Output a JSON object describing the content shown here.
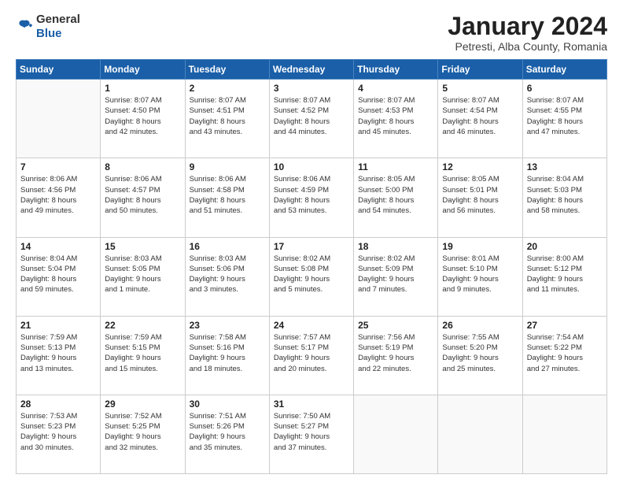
{
  "header": {
    "logo_general": "General",
    "logo_blue": "Blue",
    "month_title": "January 2024",
    "location": "Petresti, Alba County, Romania"
  },
  "weekdays": [
    "Sunday",
    "Monday",
    "Tuesday",
    "Wednesday",
    "Thursday",
    "Friday",
    "Saturday"
  ],
  "weeks": [
    [
      {
        "day": "",
        "info": ""
      },
      {
        "day": "1",
        "info": "Sunrise: 8:07 AM\nSunset: 4:50 PM\nDaylight: 8 hours\nand 42 minutes."
      },
      {
        "day": "2",
        "info": "Sunrise: 8:07 AM\nSunset: 4:51 PM\nDaylight: 8 hours\nand 43 minutes."
      },
      {
        "day": "3",
        "info": "Sunrise: 8:07 AM\nSunset: 4:52 PM\nDaylight: 8 hours\nand 44 minutes."
      },
      {
        "day": "4",
        "info": "Sunrise: 8:07 AM\nSunset: 4:53 PM\nDaylight: 8 hours\nand 45 minutes."
      },
      {
        "day": "5",
        "info": "Sunrise: 8:07 AM\nSunset: 4:54 PM\nDaylight: 8 hours\nand 46 minutes."
      },
      {
        "day": "6",
        "info": "Sunrise: 8:07 AM\nSunset: 4:55 PM\nDaylight: 8 hours\nand 47 minutes."
      }
    ],
    [
      {
        "day": "7",
        "info": "Sunrise: 8:06 AM\nSunset: 4:56 PM\nDaylight: 8 hours\nand 49 minutes."
      },
      {
        "day": "8",
        "info": "Sunrise: 8:06 AM\nSunset: 4:57 PM\nDaylight: 8 hours\nand 50 minutes."
      },
      {
        "day": "9",
        "info": "Sunrise: 8:06 AM\nSunset: 4:58 PM\nDaylight: 8 hours\nand 51 minutes."
      },
      {
        "day": "10",
        "info": "Sunrise: 8:06 AM\nSunset: 4:59 PM\nDaylight: 8 hours\nand 53 minutes."
      },
      {
        "day": "11",
        "info": "Sunrise: 8:05 AM\nSunset: 5:00 PM\nDaylight: 8 hours\nand 54 minutes."
      },
      {
        "day": "12",
        "info": "Sunrise: 8:05 AM\nSunset: 5:01 PM\nDaylight: 8 hours\nand 56 minutes."
      },
      {
        "day": "13",
        "info": "Sunrise: 8:04 AM\nSunset: 5:03 PM\nDaylight: 8 hours\nand 58 minutes."
      }
    ],
    [
      {
        "day": "14",
        "info": "Sunrise: 8:04 AM\nSunset: 5:04 PM\nDaylight: 8 hours\nand 59 minutes."
      },
      {
        "day": "15",
        "info": "Sunrise: 8:03 AM\nSunset: 5:05 PM\nDaylight: 9 hours\nand 1 minute."
      },
      {
        "day": "16",
        "info": "Sunrise: 8:03 AM\nSunset: 5:06 PM\nDaylight: 9 hours\nand 3 minutes."
      },
      {
        "day": "17",
        "info": "Sunrise: 8:02 AM\nSunset: 5:08 PM\nDaylight: 9 hours\nand 5 minutes."
      },
      {
        "day": "18",
        "info": "Sunrise: 8:02 AM\nSunset: 5:09 PM\nDaylight: 9 hours\nand 7 minutes."
      },
      {
        "day": "19",
        "info": "Sunrise: 8:01 AM\nSunset: 5:10 PM\nDaylight: 9 hours\nand 9 minutes."
      },
      {
        "day": "20",
        "info": "Sunrise: 8:00 AM\nSunset: 5:12 PM\nDaylight: 9 hours\nand 11 minutes."
      }
    ],
    [
      {
        "day": "21",
        "info": "Sunrise: 7:59 AM\nSunset: 5:13 PM\nDaylight: 9 hours\nand 13 minutes."
      },
      {
        "day": "22",
        "info": "Sunrise: 7:59 AM\nSunset: 5:15 PM\nDaylight: 9 hours\nand 15 minutes."
      },
      {
        "day": "23",
        "info": "Sunrise: 7:58 AM\nSunset: 5:16 PM\nDaylight: 9 hours\nand 18 minutes."
      },
      {
        "day": "24",
        "info": "Sunrise: 7:57 AM\nSunset: 5:17 PM\nDaylight: 9 hours\nand 20 minutes."
      },
      {
        "day": "25",
        "info": "Sunrise: 7:56 AM\nSunset: 5:19 PM\nDaylight: 9 hours\nand 22 minutes."
      },
      {
        "day": "26",
        "info": "Sunrise: 7:55 AM\nSunset: 5:20 PM\nDaylight: 9 hours\nand 25 minutes."
      },
      {
        "day": "27",
        "info": "Sunrise: 7:54 AM\nSunset: 5:22 PM\nDaylight: 9 hours\nand 27 minutes."
      }
    ],
    [
      {
        "day": "28",
        "info": "Sunrise: 7:53 AM\nSunset: 5:23 PM\nDaylight: 9 hours\nand 30 minutes."
      },
      {
        "day": "29",
        "info": "Sunrise: 7:52 AM\nSunset: 5:25 PM\nDaylight: 9 hours\nand 32 minutes."
      },
      {
        "day": "30",
        "info": "Sunrise: 7:51 AM\nSunset: 5:26 PM\nDaylight: 9 hours\nand 35 minutes."
      },
      {
        "day": "31",
        "info": "Sunrise: 7:50 AM\nSunset: 5:27 PM\nDaylight: 9 hours\nand 37 minutes."
      },
      {
        "day": "",
        "info": ""
      },
      {
        "day": "",
        "info": ""
      },
      {
        "day": "",
        "info": ""
      }
    ]
  ]
}
